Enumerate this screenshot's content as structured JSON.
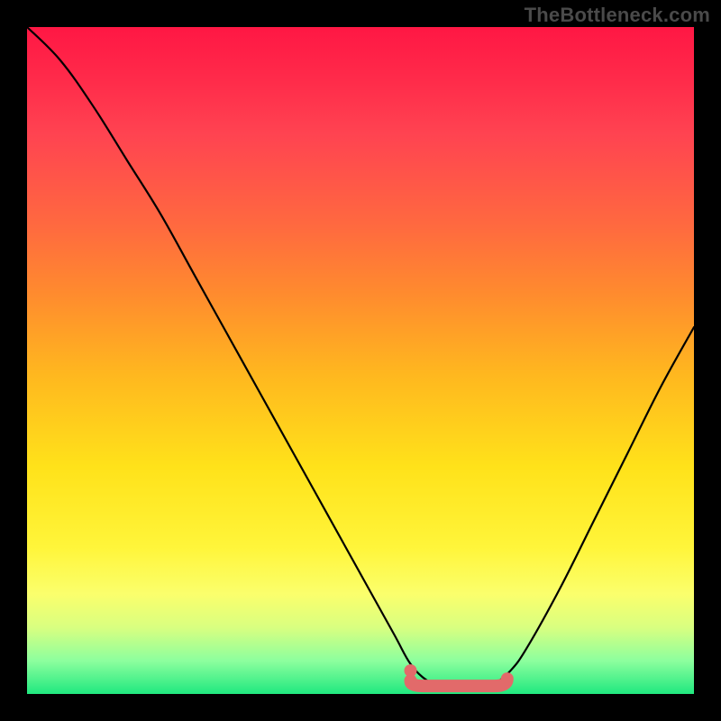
{
  "watermark": "TheBottleneck.com",
  "chart_data": {
    "type": "line",
    "title": "",
    "xlabel": "",
    "ylabel": "",
    "xlim": [
      0,
      1
    ],
    "ylim": [
      0,
      1
    ],
    "series": [
      {
        "name": "curve",
        "x": [
          0.0,
          0.05,
          0.1,
          0.15,
          0.2,
          0.25,
          0.3,
          0.35,
          0.4,
          0.45,
          0.5,
          0.55,
          0.575,
          0.6,
          0.625,
          0.65,
          0.675,
          0.7,
          0.725,
          0.75,
          0.8,
          0.85,
          0.9,
          0.95,
          1.0
        ],
        "values": [
          1.0,
          0.95,
          0.88,
          0.8,
          0.72,
          0.63,
          0.54,
          0.45,
          0.36,
          0.27,
          0.18,
          0.09,
          0.045,
          0.02,
          0.01,
          0.01,
          0.01,
          0.015,
          0.035,
          0.07,
          0.16,
          0.26,
          0.36,
          0.46,
          0.55
        ]
      }
    ],
    "trough_marker": {
      "x_start": 0.575,
      "x_end": 0.72,
      "y": 0.012,
      "dot_x": 0.575,
      "dot_y": 0.035
    },
    "background_gradient": [
      "#ff1744",
      "#ffe21a",
      "#20e87f"
    ]
  }
}
